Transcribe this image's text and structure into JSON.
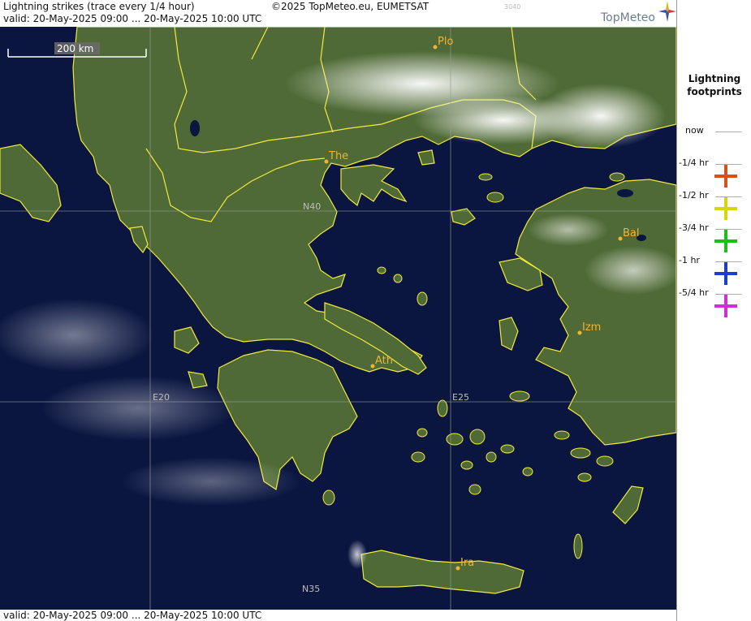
{
  "header": {
    "title": "Lightning strikes (trace every 1/4 hour)",
    "copyright": "©2025 TopMeteo.eu, EUMETSAT",
    "code": "3040",
    "valid": "valid:  20-May-2025 09:00 ... 20-May-2025 10:00 UTC",
    "logo": "TopMeteo"
  },
  "footer": {
    "valid": "valid:  20-May-2025 09:00 ... 20-May-2025 10:00 UTC"
  },
  "scale": {
    "label": "200 km"
  },
  "cities": {
    "plo": "Plo",
    "the": "The",
    "bal": "Bal",
    "izm": "Izm",
    "ath": "Ath",
    "ira": "Ira"
  },
  "grid": {
    "n40": "N40",
    "n35": "N35",
    "e20": "E20",
    "e25": "E25"
  },
  "legend": {
    "title_line1": "Lightning",
    "title_line2": "footprints",
    "items": [
      {
        "label": "now",
        "color": ""
      },
      {
        "label": "-1/4 hr",
        "color": "#d9501e"
      },
      {
        "label": "-1/2 hr",
        "color": "#d6d600"
      },
      {
        "label": "-3/4 hr",
        "color": "#18c018"
      },
      {
        "label": "-1 hr",
        "color": "#1a3fd0"
      },
      {
        "label": "-5/4 hr",
        "color": "#d22fd2"
      }
    ]
  },
  "colors": {
    "sea": "#0b1640",
    "land": "#4f6a36",
    "border": "#f2ea3a",
    "city": "#f2b233"
  }
}
